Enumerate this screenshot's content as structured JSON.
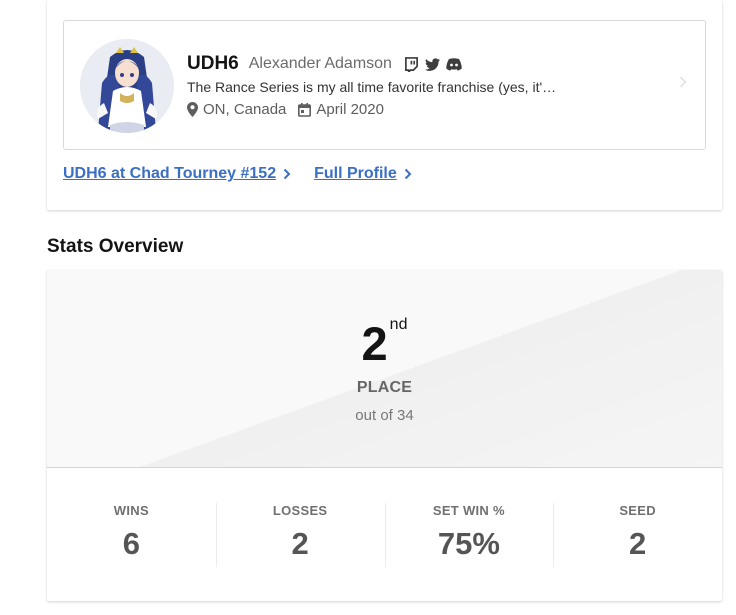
{
  "player": {
    "tag": "UDH6",
    "real_name": "Alexander Adamson",
    "bio": "The Rance Series is my all time favorite franchise (yes, it's an eroge RPG). ...",
    "location": "ON, Canada",
    "joined": "April 2020",
    "social_icons": [
      "twitch-icon",
      "twitter-icon",
      "discord-icon"
    ]
  },
  "links": {
    "tournament": "UDH6 at Chad Tourney #152",
    "profile": "Full Profile"
  },
  "stats_overview": {
    "title": "Stats Overview",
    "placement": "2",
    "placement_suffix": "nd",
    "place_label": "PLACE",
    "out_of": "out of 34",
    "stats": [
      {
        "label": "WINS",
        "value": "6"
      },
      {
        "label": "LOSSES",
        "value": "2"
      },
      {
        "label": "SET WIN %",
        "value": "75%"
      },
      {
        "label": "SEED",
        "value": "2"
      }
    ]
  },
  "colors": {
    "link": "#3b6fc4",
    "text_dark": "#141414",
    "text_muted": "#6b6b6b"
  }
}
